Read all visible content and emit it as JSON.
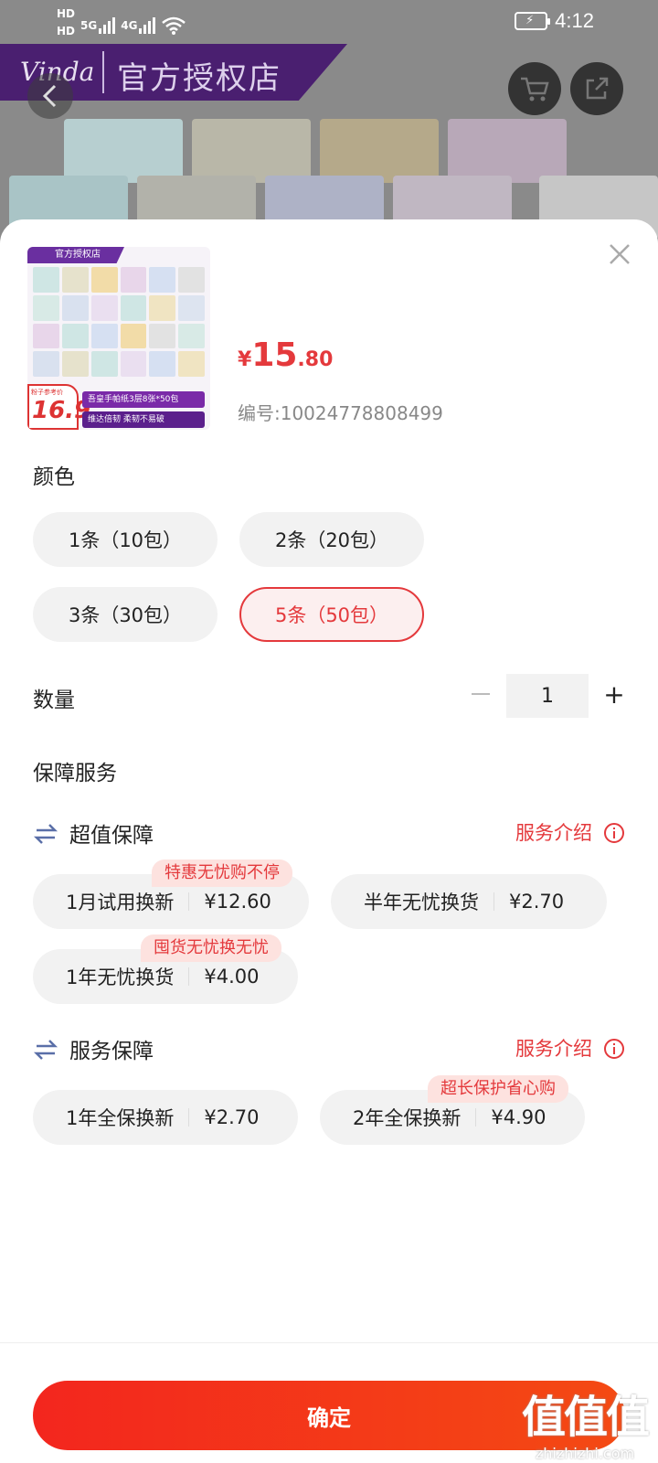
{
  "status_bar": {
    "hd1": "HD",
    "hd2": "HD",
    "net1": "5G",
    "net2": "4G",
    "time": "4:12"
  },
  "background": {
    "brand_logo": "Vinda",
    "banner_text": "官方授权店"
  },
  "product": {
    "thumb_tag": "官方授权店",
    "thumb_price_label": "粉子参考价",
    "thumb_price": "16.9",
    "thumb_caption1": "吾皇手帕纸3层8张*50包",
    "thumb_caption2": "维达倍韧 柔韧不易破",
    "currency": "¥",
    "price_int": "15",
    "price_dec": ".80",
    "sku": "编号:100247788084​99"
  },
  "color_section": {
    "title": "颜色",
    "options": [
      {
        "label": "1条（10包）",
        "selected": false
      },
      {
        "label": "2条（20包）",
        "selected": false
      },
      {
        "label": "3条（30包）",
        "selected": false
      },
      {
        "label": "5条（50包）",
        "selected": true
      }
    ]
  },
  "quantity": {
    "title": "数量",
    "value": "1"
  },
  "services": {
    "title": "保障服务",
    "groups": [
      {
        "title": "超值保障",
        "intro": "服务介绍",
        "items": [
          {
            "name": "1月试用换新",
            "price": "¥12.60",
            "tag": "特惠无忧购不停"
          },
          {
            "name": "半年无忧换货",
            "price": "¥2.70",
            "tag": ""
          },
          {
            "name": "1年无忧换货",
            "price": "¥4.00",
            "tag": "囤货无忧换无忧"
          }
        ]
      },
      {
        "title": "服务保障",
        "intro": "服务介绍",
        "items": [
          {
            "name": "1年全保换新",
            "price": "¥2.70",
            "tag": ""
          },
          {
            "name": "2年全保换新",
            "price": "¥4.90",
            "tag": "超长保护省心购"
          }
        ]
      }
    ]
  },
  "confirm_label": "确定",
  "watermark": {
    "big": "值值值",
    "small": "zhizhizhi.com"
  },
  "colors": {
    "accent": "#e4393c",
    "chip_bg": "#f2f2f2",
    "tag_bg": "#fde2df"
  }
}
